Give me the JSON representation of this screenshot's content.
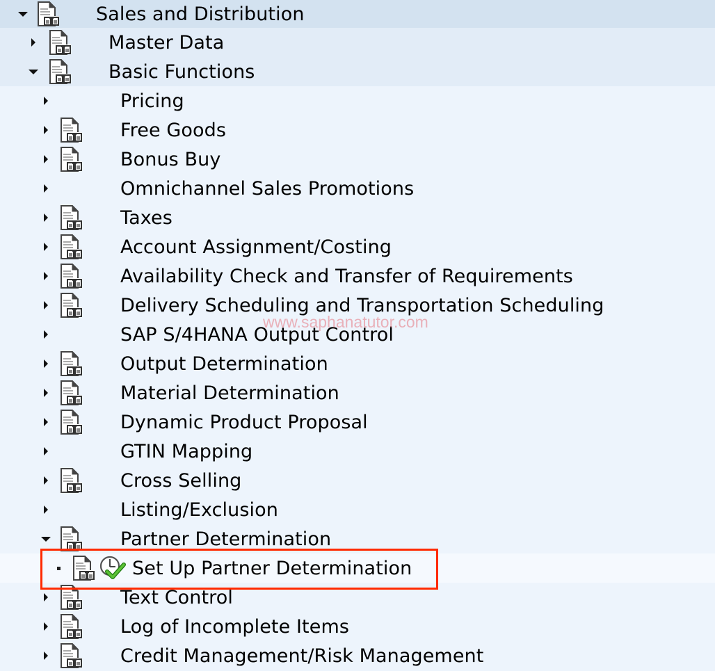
{
  "tree": {
    "nodes": [
      {
        "label": "Sales and Distribution",
        "level": 0,
        "state": "expanded",
        "has_doc_icon": true
      },
      {
        "label": "Master Data",
        "level": 1,
        "state": "collapsed",
        "has_doc_icon": true
      },
      {
        "label": "Basic Functions",
        "level": 1,
        "state": "expanded",
        "has_doc_icon": true
      },
      {
        "label": "Pricing",
        "level": 2,
        "state": "collapsed",
        "has_doc_icon": false
      },
      {
        "label": "Free Goods",
        "level": 2,
        "state": "collapsed",
        "has_doc_icon": true
      },
      {
        "label": "Bonus Buy",
        "level": 2,
        "state": "collapsed",
        "has_doc_icon": true
      },
      {
        "label": "Omnichannel Sales Promotions",
        "level": 2,
        "state": "collapsed",
        "has_doc_icon": false
      },
      {
        "label": "Taxes",
        "level": 2,
        "state": "collapsed",
        "has_doc_icon": true
      },
      {
        "label": "Account Assignment/Costing",
        "level": 2,
        "state": "collapsed",
        "has_doc_icon": true
      },
      {
        "label": "Availability Check and Transfer of Requirements",
        "level": 2,
        "state": "collapsed",
        "has_doc_icon": true
      },
      {
        "label": "Delivery Scheduling and Transportation Scheduling",
        "level": 2,
        "state": "collapsed",
        "has_doc_icon": true
      },
      {
        "label": "SAP S/4HANA Output Control",
        "level": 2,
        "state": "collapsed",
        "has_doc_icon": false
      },
      {
        "label": "Output Determination",
        "level": 2,
        "state": "collapsed",
        "has_doc_icon": true
      },
      {
        "label": "Material Determination",
        "level": 2,
        "state": "collapsed",
        "has_doc_icon": true
      },
      {
        "label": "Dynamic Product Proposal",
        "level": 2,
        "state": "collapsed",
        "has_doc_icon": true
      },
      {
        "label": "GTIN Mapping",
        "level": 2,
        "state": "collapsed",
        "has_doc_icon": false
      },
      {
        "label": "Cross Selling",
        "level": 2,
        "state": "collapsed",
        "has_doc_icon": true
      },
      {
        "label": "Listing/Exclusion",
        "level": 2,
        "state": "collapsed",
        "has_doc_icon": false
      },
      {
        "label": "Partner Determination",
        "level": 2,
        "state": "expanded",
        "has_doc_icon": true
      },
      {
        "label": "Set Up Partner Determination",
        "level": 3,
        "state": "leaf",
        "has_doc_icon": true,
        "has_execute_icon": true,
        "highlighted": true
      },
      {
        "label": "Text Control",
        "level": 2,
        "state": "collapsed",
        "has_doc_icon": true
      },
      {
        "label": "Log of Incomplete Items",
        "level": 2,
        "state": "collapsed",
        "has_doc_icon": true
      },
      {
        "label": "Credit Management/Risk Management",
        "level": 2,
        "state": "collapsed",
        "has_doc_icon": true
      }
    ]
  },
  "watermark": "www.saphanatutor.com",
  "colors": {
    "highlight_box": "#ff2a00",
    "row_level0": "#d3e2f0",
    "row_level1": "#e2ecf7",
    "row_default": "#edf4fc",
    "row_selected": "#f5f9fe",
    "check_green": "#3aa51d"
  }
}
